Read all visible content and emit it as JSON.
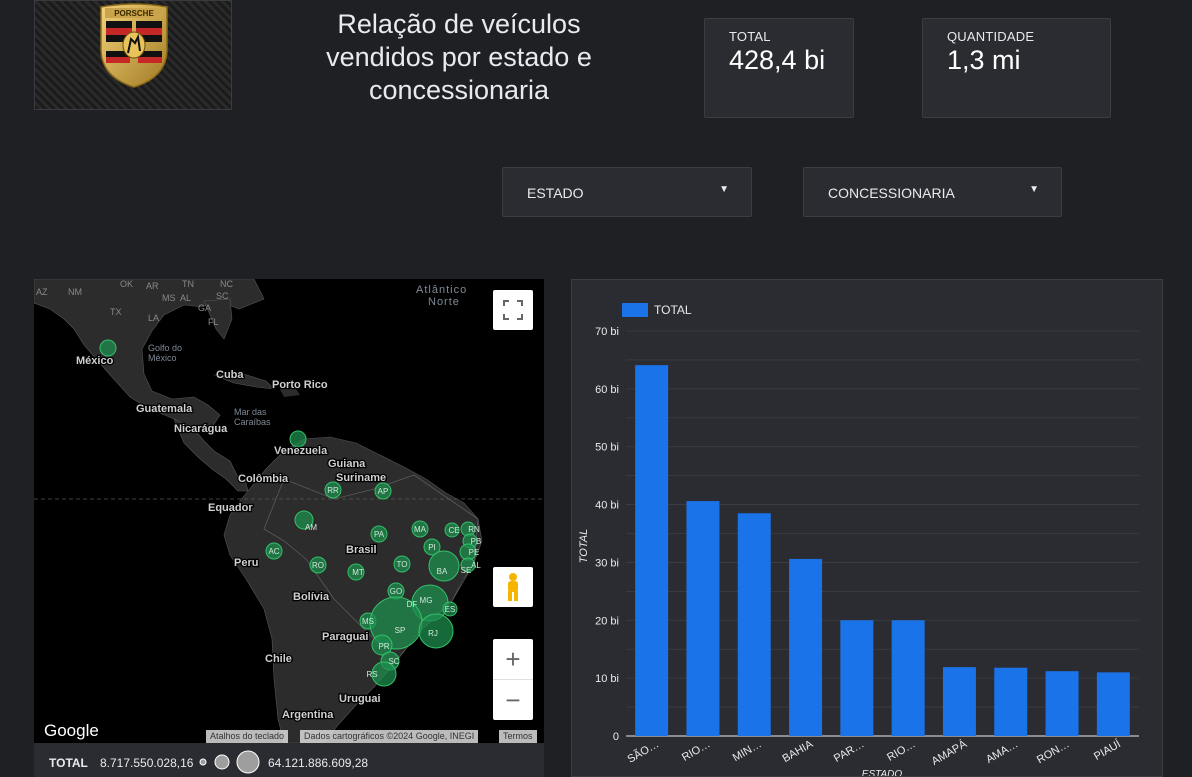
{
  "header": {
    "title_lines": [
      "Relação de veículos",
      "vendidos por estado e",
      "concessionaria"
    ],
    "logo_text": "PORSCHE"
  },
  "kpis": {
    "total": {
      "label": "TOTAL",
      "value": "428,4 bi"
    },
    "quantidade": {
      "label": "QUANTIDADE",
      "value": "1,3 mi"
    }
  },
  "filters": {
    "estado": {
      "label": "ESTADO",
      "icon": "caret-down-icon"
    },
    "concessionaria": {
      "label": "CONCESSIONARIA",
      "icon": "caret-down-icon"
    }
  },
  "map": {
    "place_labels": {
      "atlantico": "Atlântico",
      "norte": "Norte",
      "golfo": "Golfo do",
      "golfo2": "México",
      "mexico": "México",
      "cuba": "Cuba",
      "porto_rico": "Porto Rico",
      "guatemala": "Guatemala",
      "nicaragua": "Nicarágua",
      "mar": "Mar das",
      "mar2": "Caraíbas",
      "venezuela": "Venezuela",
      "guiana": "Guiana",
      "suriname": "Suriname",
      "colombia": "Colômbia",
      "equador": "Equador",
      "brasil": "Brasil",
      "peru": "Peru",
      "bolivia": "Bolívia",
      "paraguai": "Paraguai",
      "chile": "Chile",
      "uruguai": "Uruguai",
      "argentina": "Argentina",
      "az": "AZ",
      "nm": "NM",
      "ok": "OK",
      "ar": "AR",
      "tn": "TN",
      "nc": "NC",
      "ms": "MS",
      "al": "AL",
      "ga": "GA",
      "sc": "SC",
      "tx": "TX",
      "la": "LA",
      "fl": "FL"
    },
    "bubble_labels": {
      "rr": "RR",
      "ap": "AP",
      "am": "AM",
      "pa": "PA",
      "ma": "MA",
      "ce": "CE",
      "rn": "RN",
      "pb": "PB",
      "pe": "PE",
      "al": "AL",
      "se": "SE",
      "pi": "PI",
      "ac": "AC",
      "ro": "RO",
      "mt": "MT",
      "to": "TO",
      "ba": "BA",
      "go": "GO",
      "df": "DF",
      "mg": "MG",
      "es": "ES",
      "ms": "MS",
      "sp": "SP",
      "rj": "RJ",
      "pr": "PR",
      "sc": "SC",
      "rs": "RS"
    },
    "google_logo": "Google",
    "attribution": {
      "keyboard": "Atalhos do teclado",
      "data": "Dados cartográficos ©2024 Google, INEGI",
      "terms": "Termos"
    },
    "legend": {
      "label": "TOTAL",
      "min": "8.717.550.028,16",
      "max": "64.121.886.609,28"
    },
    "controls": {
      "fullscreen": "fullscreen-icon",
      "pegman": "pegman-icon",
      "zoom_in": "+",
      "zoom_out": "−"
    },
    "bubble_color": "#1e8e4e"
  },
  "chart_data": {
    "type": "bar",
    "legend": [
      "TOTAL"
    ],
    "categories": [
      "SÃO…",
      "RIO…",
      "MIN…",
      "BAHIA",
      "PAR…",
      "RIO…",
      "AMAPÁ",
      "AMA…",
      "RON…",
      "PIAUÍ"
    ],
    "series": [
      {
        "name": "TOTAL",
        "values": [
          64.1,
          40.6,
          38.5,
          30.6,
          20.0,
          20.0,
          11.9,
          11.8,
          11.2,
          11.0
        ]
      }
    ],
    "yticks": [
      "0",
      "10 bi",
      "20 bi",
      "30 bi",
      "40 bi",
      "50 bi",
      "60 bi",
      "70 bi"
    ],
    "ylim": [
      0,
      70
    ],
    "ylabel": "TOTAL",
    "xlabel": "ESTADO",
    "bar_color": "#1a73e8",
    "grid": true,
    "legend_position": "top-left"
  }
}
